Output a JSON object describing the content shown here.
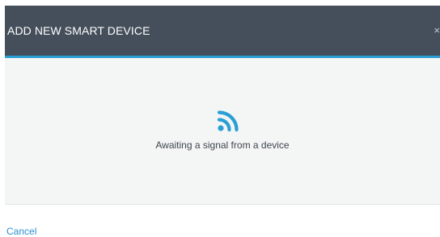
{
  "dialog": {
    "title": "ADD NEW SMART DEVICE",
    "close_icon": "close-icon",
    "close_glyph": "×"
  },
  "body": {
    "icon": "wifi-signal-icon",
    "status_text": "Awaiting a signal from a device"
  },
  "footer": {
    "cancel_label": "Cancel"
  },
  "colors": {
    "header_bg": "#454f5b",
    "accent": "#2a9fd6",
    "body_bg": "#f4f5f5",
    "link": "#2a8fcf"
  }
}
